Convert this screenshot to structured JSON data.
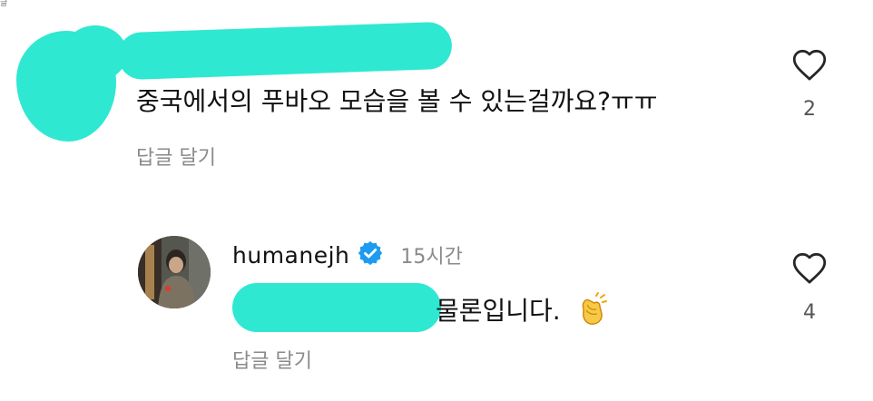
{
  "top_fragment": "글",
  "comment": {
    "text": "중국에서의 푸바오 모습을 볼 수 있는걸까요?ㅠㅠ",
    "reply_label": "답글 달기",
    "like_count": "2"
  },
  "reply": {
    "username": "humanejh",
    "time": "15시간",
    "text": "물론입니다. ",
    "reply_label": "답글 달기",
    "like_count": "4"
  },
  "icons": {
    "heart": "heart-outline-icon",
    "verified": "verified-badge-icon",
    "clap": "clapping-hands-emoji"
  },
  "colors": {
    "redaction": "#2fe8d2",
    "verified": "#1d9bf0",
    "muted_text": "#8a8a8a"
  }
}
